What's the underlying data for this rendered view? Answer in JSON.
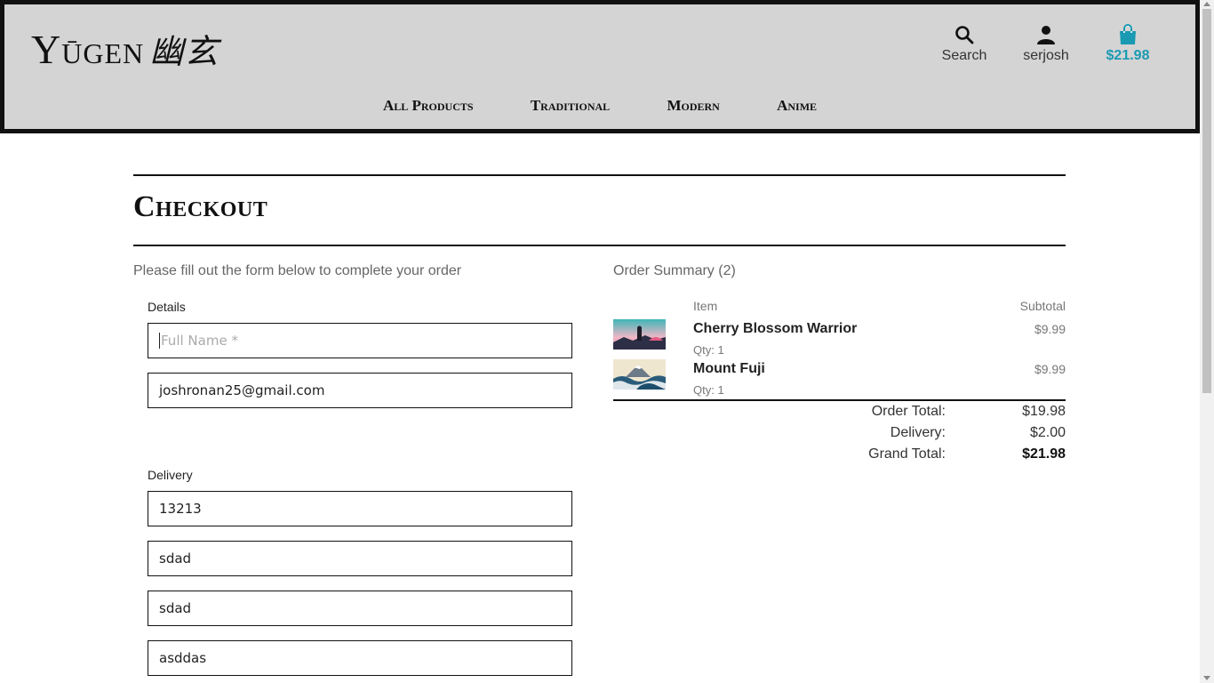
{
  "header": {
    "logo_text": "Yūgen",
    "logo_kanji": "幽玄",
    "search_label": "Search",
    "account_label": "serjosh",
    "cart_total": "$21.98",
    "accent_color": "#1a9ab3",
    "nav": [
      "All Products",
      "Traditional",
      "Modern",
      "Anime"
    ]
  },
  "page": {
    "title": "Checkout",
    "intro": "Please fill out the form below to complete your order"
  },
  "form": {
    "details_label": "Details",
    "full_name_placeholder": "Full Name *",
    "email_value": "joshronan25@gmail.com",
    "delivery_label": "Delivery",
    "delivery_fields": [
      "13213",
      "sdad",
      "sdad",
      "asddas"
    ]
  },
  "summary": {
    "title": "Order Summary (2)",
    "col_item": "Item",
    "col_subtotal": "Subtotal",
    "items": [
      {
        "name": "Cherry Blossom Warrior",
        "qty": "Qty: 1",
        "price": "$9.99"
      },
      {
        "name": "Mount Fuji",
        "qty": "Qty: 1",
        "price": "$9.99"
      }
    ],
    "order_total_label": "Order Total:",
    "order_total": "$19.98",
    "delivery_label": "Delivery:",
    "delivery": "$2.00",
    "grand_total_label": "Grand Total:",
    "grand_total": "$21.98"
  }
}
